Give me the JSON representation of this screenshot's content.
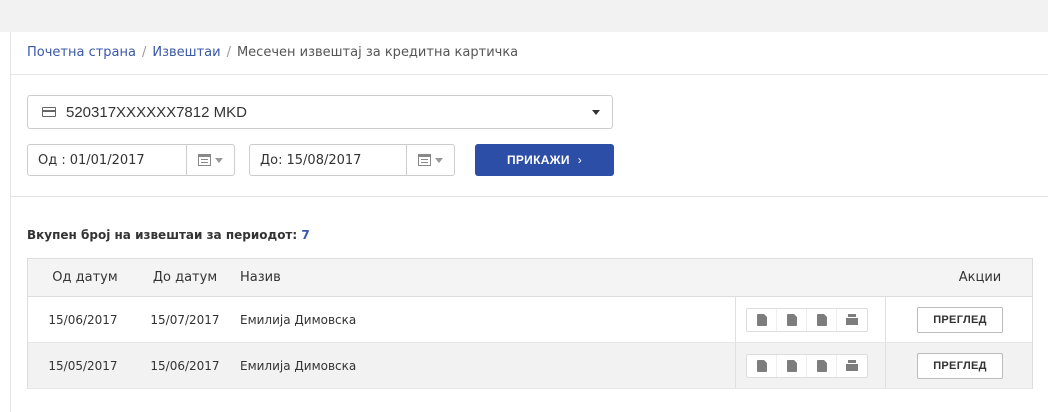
{
  "breadcrumb": {
    "home": "Почетна страна",
    "reports": "Извештаи",
    "separator": "/",
    "current": "Месечен извештај за кредитна картичка"
  },
  "card_select": {
    "value": "520317XXXXXX7812 MKD",
    "icon": "credit-card-icon"
  },
  "filters": {
    "from_label": "Од :",
    "from_value": "01/01/2017",
    "to_label": "До:",
    "to_value": "15/08/2017",
    "show_button": "ПРИКАЖИ",
    "show_chevron": "›"
  },
  "summary": {
    "label": "Вкупен број на извештаи за периодот:",
    "count": "7"
  },
  "table": {
    "headers": {
      "from": "Од датум",
      "to": "До датум",
      "name": "Назив",
      "actions": "Акции"
    },
    "rows": [
      {
        "from": "15/06/2017",
        "to": "15/07/2017",
        "name": "Емилија Димовска",
        "action": "ПРЕГЛЕД"
      },
      {
        "from": "15/05/2017",
        "to": "15/06/2017",
        "name": "Емилија Димовска",
        "action": "ПРЕГЛЕД"
      }
    ],
    "export_icons": [
      "html-export-icon",
      "excel-export-icon",
      "pdf-export-icon",
      "print-icon"
    ]
  },
  "colors": {
    "primary": "#2d4ea6",
    "link": "#3a58a8",
    "header_bg": "#f4f4f4",
    "alt_row": "#f2f2f2"
  }
}
